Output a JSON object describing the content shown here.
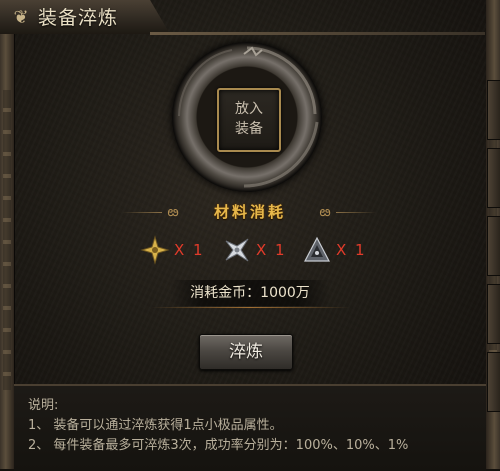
{
  "window": {
    "title": "装备淬炼",
    "icon": "dragon-emblem-icon"
  },
  "slot": {
    "line1": "放入",
    "line2": "装备"
  },
  "materials": {
    "title": "材料消耗",
    "items": [
      {
        "icon": "gold-star-shuriken-icon",
        "count": "X 1"
      },
      {
        "icon": "silver-shuriken-icon",
        "count": "X 1"
      },
      {
        "icon": "dark-triangle-shuriken-icon",
        "count": "X 1"
      }
    ]
  },
  "cost": {
    "text": "消耗金币：1000万"
  },
  "actions": {
    "refine_label": "淬炼"
  },
  "description": {
    "heading": "说明:",
    "lines": [
      "1、 装备可以通过淬炼获得1点小极品属性。",
      "2、 每件装备最多可淬炼3次，成功率分别为：100%、10%、1%"
    ]
  },
  "colors": {
    "materials_title": "#e7b84b",
    "count_red": "#e23b2a",
    "slot_border": "#a98a4f"
  }
}
